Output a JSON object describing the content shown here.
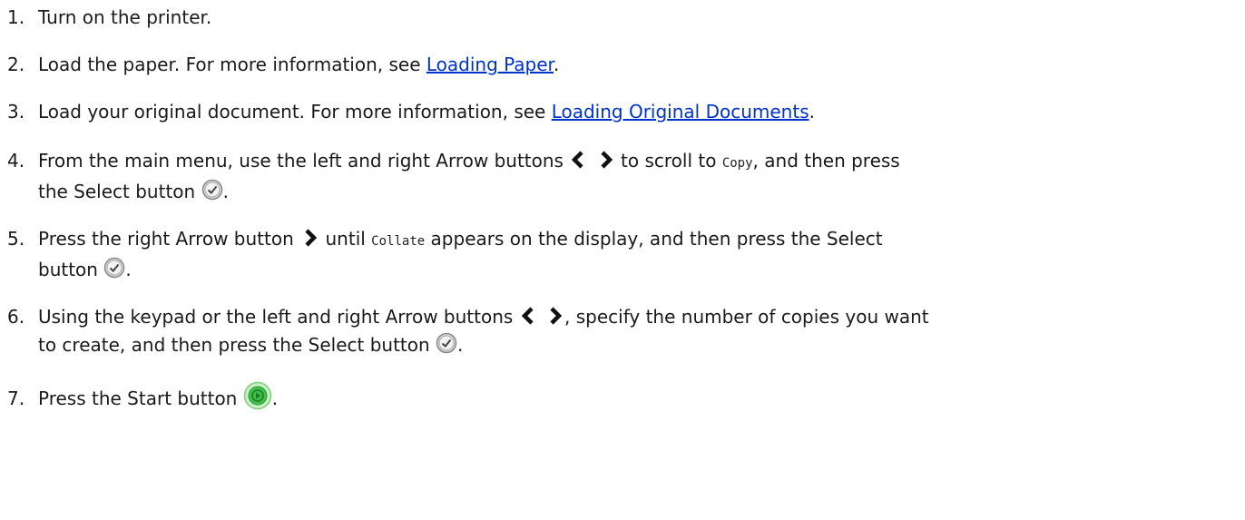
{
  "steps": [
    {
      "num": "1.",
      "text": "Turn on the printer."
    },
    {
      "num": "2.",
      "text_before": "Load the paper. For more information, see ",
      "link": "Loading Paper",
      "text_after": "."
    },
    {
      "num": "3.",
      "text_before": "Load your original document. For more information, see ",
      "link": "Loading Original Documents",
      "text_after": "."
    },
    {
      "num": "4.",
      "text_a": "From the main menu, use the left and right Arrow buttons ",
      "text_b": " to scroll to ",
      "code": "Copy",
      "text_c": ", and then press",
      "line2": "the Select button",
      "line2_end": "."
    },
    {
      "num": "5.",
      "text_a": "Press the right Arrow button ",
      "text_b": " until ",
      "code": "Collate",
      "text_c": " appears on the display, and then press the Select",
      "line2": "button",
      "line2_end": "."
    },
    {
      "num": "6.",
      "text_a": "Using the keypad or the left and right Arrow buttons ",
      "text_b": ", specify the number of copies you want",
      "line2": "to create, and then press the Select button",
      "line2_end": "."
    },
    {
      "num": "7.",
      "text_a": "Press the Start button ",
      "text_end": "."
    }
  ],
  "icons": {
    "arrow_left": "left-arrow-icon",
    "arrow_right": "right-arrow-icon",
    "select": "select-button-icon",
    "start": "start-button-icon"
  },
  "colors": {
    "link": "#0033cc",
    "text": "#1a1a1a",
    "start_green": "#3ec04a"
  }
}
